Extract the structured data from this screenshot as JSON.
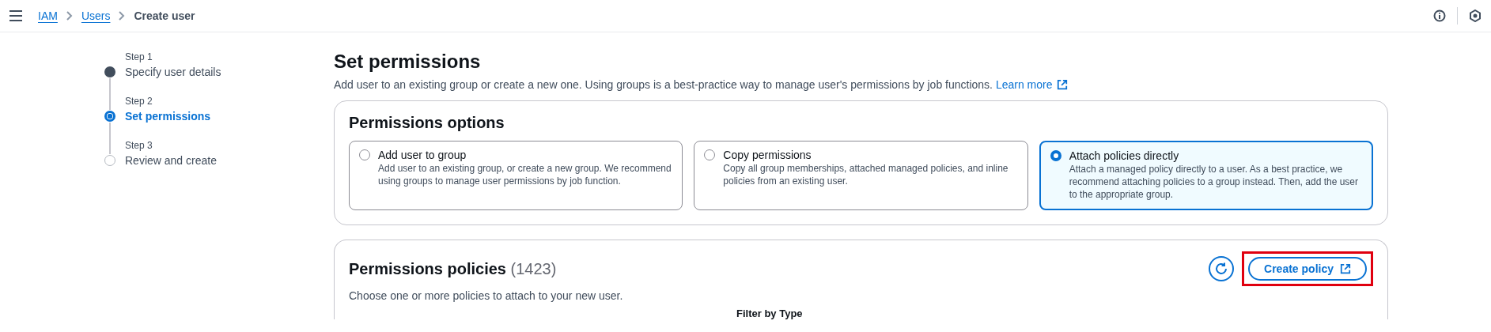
{
  "top_bar": {
    "breadcrumbs": [
      {
        "label": "IAM",
        "link": true
      },
      {
        "label": "Users",
        "link": true
      },
      {
        "label": "Create user",
        "link": false
      }
    ]
  },
  "steps": [
    {
      "step": "Step 1",
      "label": "Specify user details",
      "kind": "done"
    },
    {
      "step": "Step 2",
      "label": "Set permissions",
      "kind": "current"
    },
    {
      "step": "Step 3",
      "label": "Review and create",
      "kind": "todo"
    }
  ],
  "page": {
    "title": "Set permissions",
    "description": "Add user to an existing group or create a new one. Using groups is a best-practice way to manage user's permissions by job functions.",
    "learn_more": "Learn more"
  },
  "permissions_options": {
    "title": "Permissions options",
    "options": [
      {
        "label": "Add user to group",
        "description": "Add user to an existing group, or create a new group. We recommend using groups to manage user permissions by job function.",
        "selected": false
      },
      {
        "label": "Copy permissions",
        "description": "Copy all group memberships, attached managed policies, and inline policies from an existing user.",
        "selected": false
      },
      {
        "label": "Attach policies directly",
        "description": "Attach a managed policy directly to a user. As a best practice, we recommend attaching policies to a group instead. Then, add the user to the appropriate group.",
        "selected": true
      }
    ]
  },
  "permissions_policies": {
    "title": "Permissions policies",
    "count": "(1423)",
    "description": "Choose one or more policies to attach to your new user.",
    "create_policy": {
      "label": "Create policy",
      "highlighted": true
    },
    "filter_label": "Filter by Type"
  }
}
